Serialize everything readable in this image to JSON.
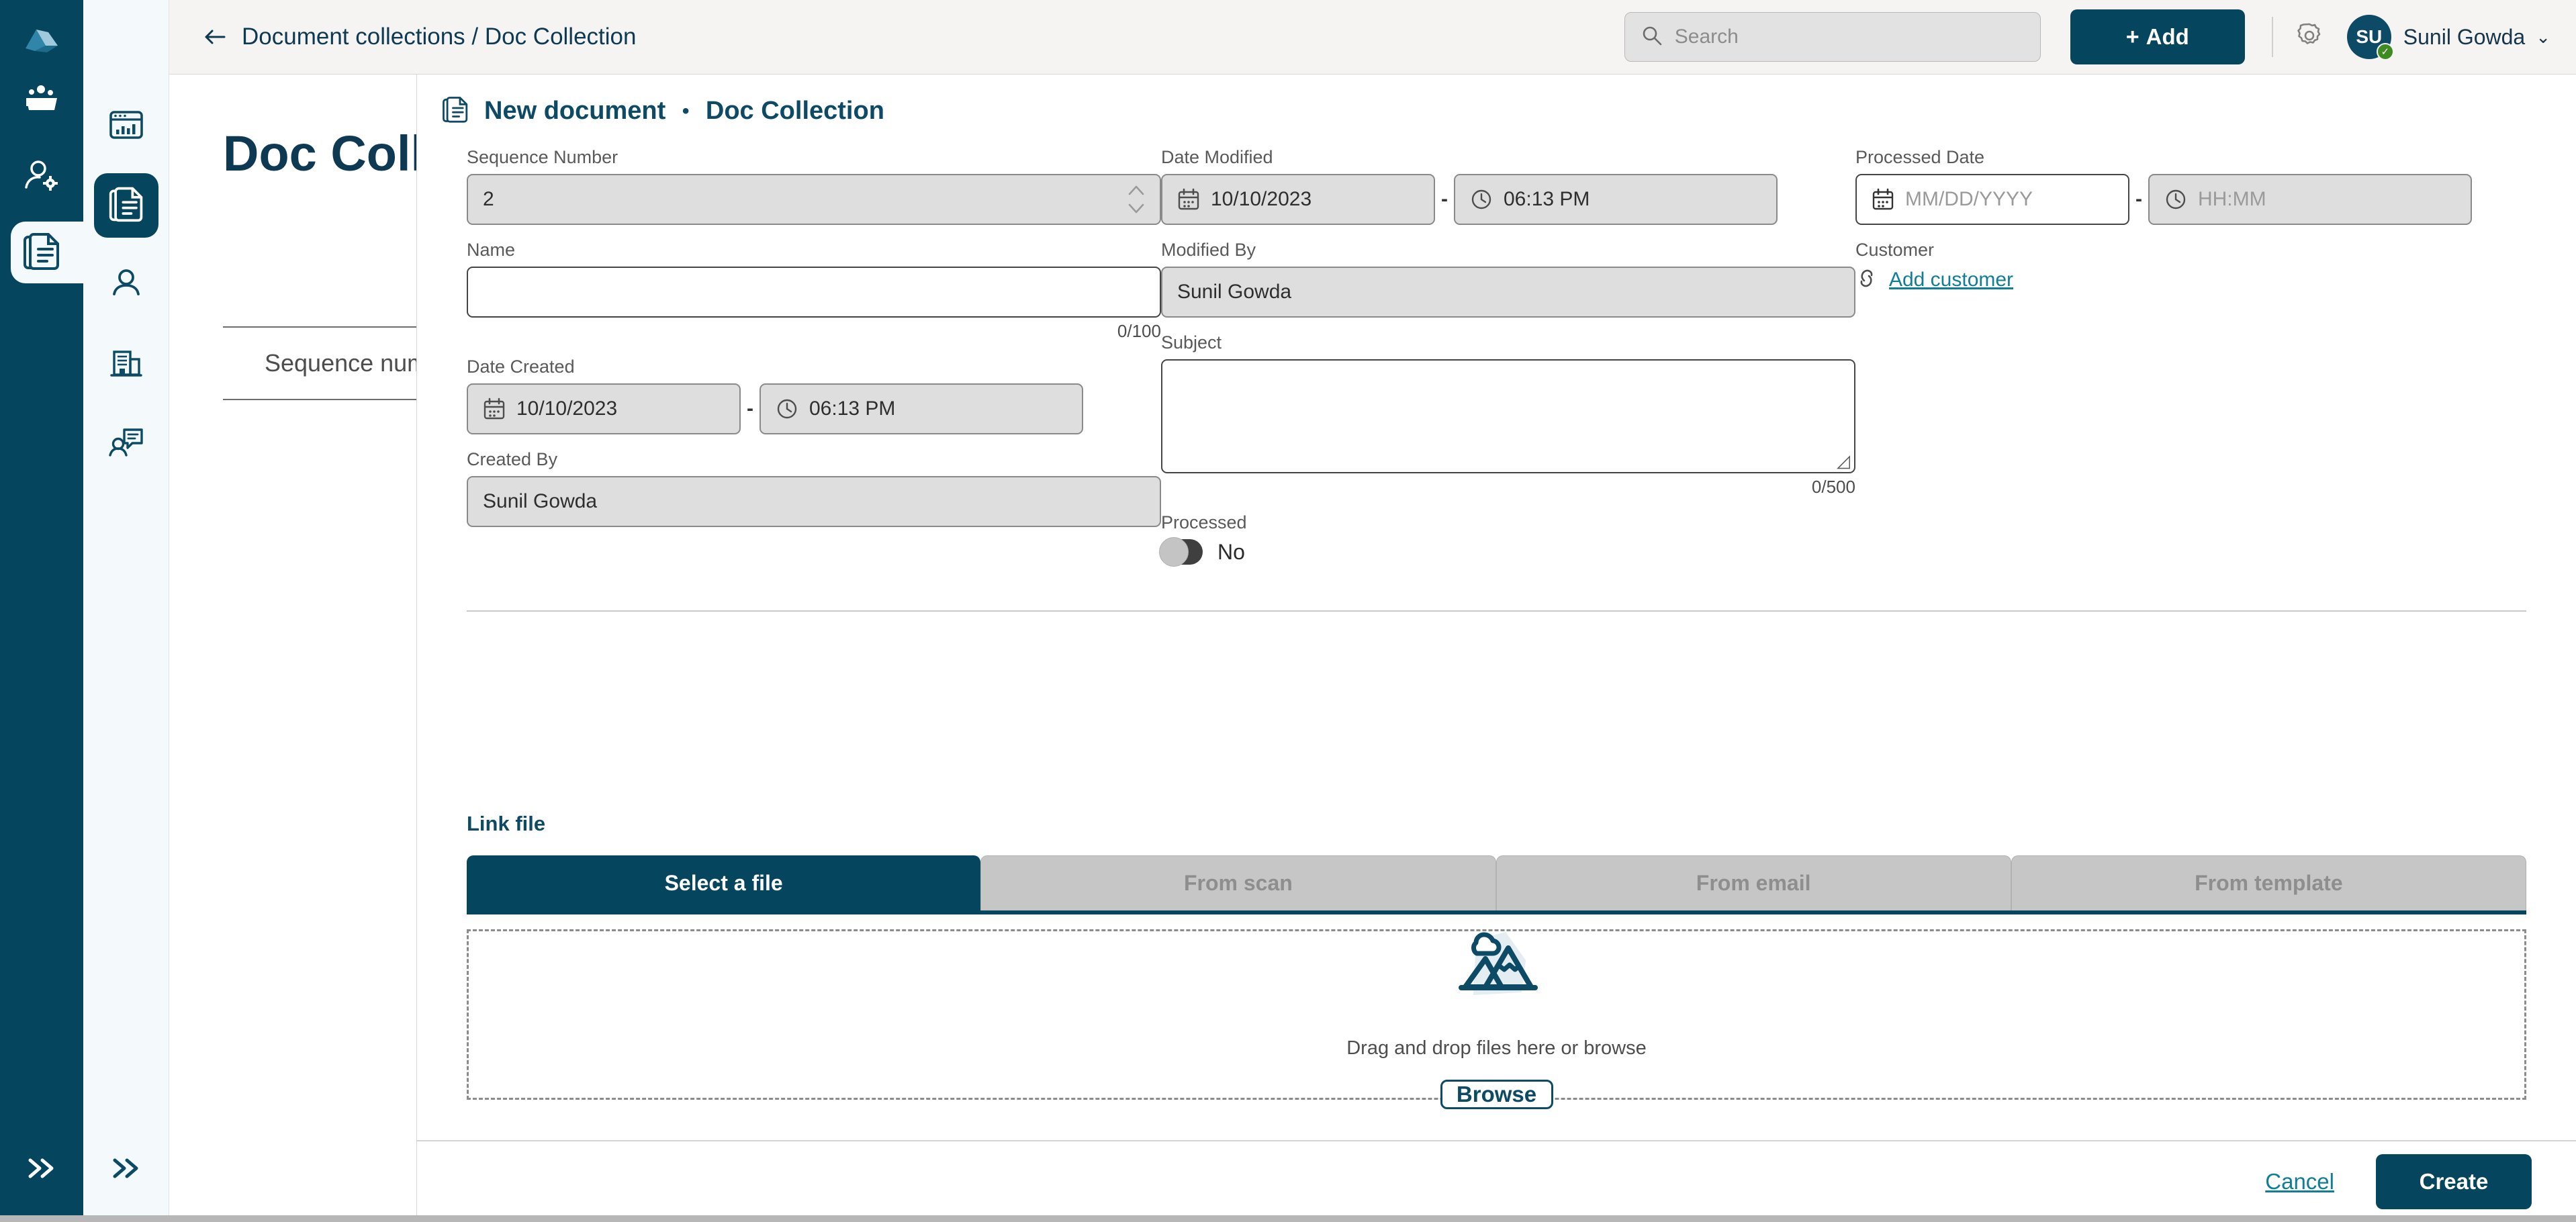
{
  "topbar": {
    "breadcrumb": "Document collections / Doc Collection",
    "back_icon": "arrow-left-icon",
    "search": {
      "placeholder": "Search",
      "value": "",
      "icon": "search-icon"
    },
    "add_button": "Add",
    "add_plus": "+",
    "gear_icon": "gear-icon",
    "user": {
      "initials": "SU",
      "name": "Sunil Gowda",
      "caret": "⌄",
      "status": "online"
    }
  },
  "sidebar_dark": {
    "logo_icon": "cloud-logo-icon",
    "items": [
      {
        "icon": "dashboard-folder-icon",
        "active": false
      },
      {
        "icon": "user-settings-icon",
        "active": false
      },
      {
        "icon": "documents-icon",
        "active": true
      }
    ],
    "expand_icon": "chevron-double-right-icon"
  },
  "sidebar_light": {
    "items": [
      {
        "icon": "analytics-window-icon",
        "active": false
      },
      {
        "icon": "documents-icon",
        "active": true
      },
      {
        "icon": "person-icon",
        "active": false
      },
      {
        "icon": "building-icon",
        "active": false
      },
      {
        "icon": "contact-message-icon",
        "active": false
      }
    ],
    "expand_icon": "chevron-double-right-icon"
  },
  "background_page": {
    "title": "Doc Colle",
    "table_header": "Sequence number"
  },
  "modal": {
    "header": {
      "icon": "document-icon",
      "title": "New document",
      "separator": "•",
      "subtitle": "Doc Collection"
    },
    "fields": {
      "sequence_number": {
        "label": "Sequence Number",
        "value": "2",
        "disabled": true,
        "spinner": "stepper-icon"
      },
      "name": {
        "label": "Name",
        "value": "",
        "placeholder": "",
        "counter": "0/100"
      },
      "date_created": {
        "label": "Date Created",
        "date_value": "10/10/2023",
        "date_icon": "calendar-icon",
        "separator": "-",
        "time_value": "06:13 PM",
        "time_icon": "clock-icon",
        "disabled": true
      },
      "created_by": {
        "label": "Created By",
        "value": "Sunil  Gowda",
        "disabled": true
      },
      "date_modified": {
        "label": "Date Modified",
        "date_value": "10/10/2023",
        "date_icon": "calendar-icon",
        "separator": "-",
        "time_value": "06:13 PM",
        "time_icon": "clock-icon",
        "disabled": true
      },
      "modified_by": {
        "label": "Modified By",
        "value": "Sunil  Gowda",
        "disabled": true
      },
      "subject": {
        "label": "Subject",
        "value": "",
        "counter": "0/500"
      },
      "processed": {
        "label": "Processed",
        "toggle_state": "off",
        "toggle_value": "No"
      },
      "processed_date": {
        "label": "Processed Date",
        "date_placeholder": "MM/DD/YYYY",
        "date_icon": "calendar-icon",
        "separator": "-",
        "time_placeholder": "HH:MM",
        "time_icon": "clock-icon",
        "time_disabled": true
      },
      "customer": {
        "label": "Customer",
        "link_label": "Add customer",
        "link_icon": "link-icon"
      }
    },
    "link_file": {
      "section_title": "Link file",
      "tabs": [
        {
          "label": "Select a file",
          "active": true
        },
        {
          "label": "From scan",
          "active": false
        },
        {
          "label": "From email",
          "active": false
        },
        {
          "label": "From template",
          "active": false
        }
      ],
      "dropzone": {
        "icon": "image-upload-icon",
        "text": "Drag and drop files here or browse",
        "browse_label": "Browse"
      }
    },
    "footer": {
      "cancel_label": "Cancel",
      "create_label": "Create"
    }
  },
  "colors": {
    "brand_dark": "#06455e",
    "brand_mid": "#0d4a66",
    "link_teal": "#0f7e96",
    "rail_light": "#f4f9fc",
    "topbar_bg": "#f5f4f2",
    "disabled_field": "#dedede",
    "tab_inactive": "#c6c6c6",
    "online_green": "#3f8a21"
  }
}
